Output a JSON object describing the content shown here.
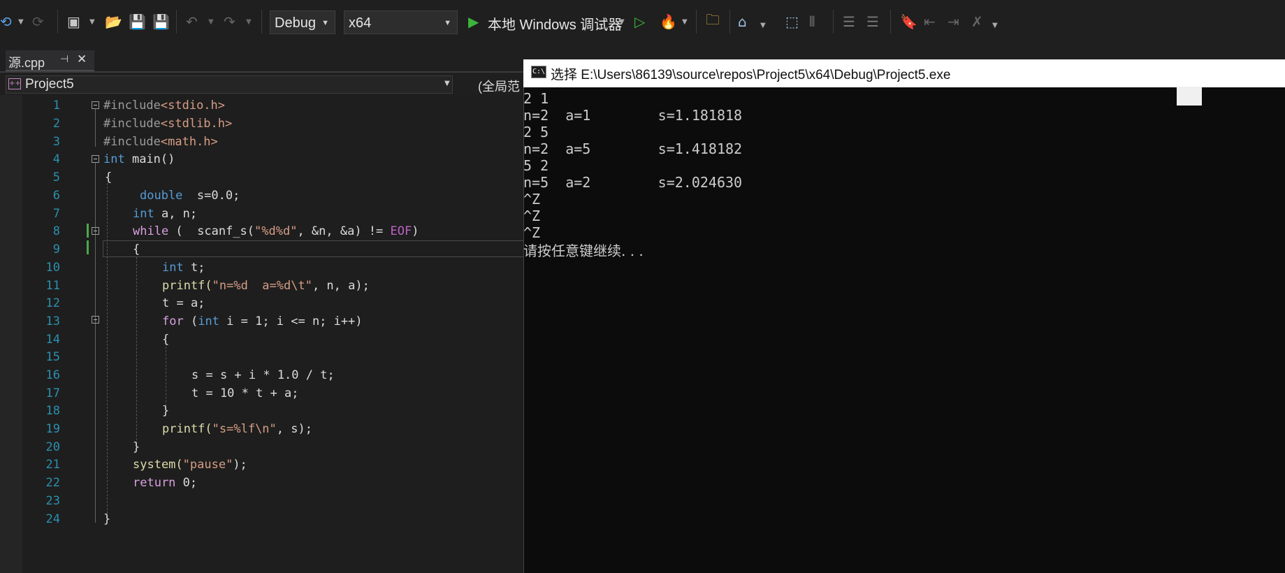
{
  "toolbar": {
    "config": "Debug",
    "platform": "x64",
    "run_label": "本地 Windows 调试器"
  },
  "tab": {
    "name": "源.cpp",
    "pin": "⊣",
    "close": "✕"
  },
  "nav": {
    "project": "Project5",
    "scope": "(全局范"
  },
  "code_lines": [
    {
      "n": "1"
    },
    {
      "n": "2"
    },
    {
      "n": "3"
    },
    {
      "n": "4"
    },
    {
      "n": "5"
    },
    {
      "n": "6"
    },
    {
      "n": "7"
    },
    {
      "n": "8"
    },
    {
      "n": "9"
    },
    {
      "n": "10"
    },
    {
      "n": "11"
    },
    {
      "n": "12"
    },
    {
      "n": "13"
    },
    {
      "n": "14"
    },
    {
      "n": "15"
    },
    {
      "n": "16"
    },
    {
      "n": "17"
    },
    {
      "n": "18"
    },
    {
      "n": "19"
    },
    {
      "n": "20"
    },
    {
      "n": "21"
    },
    {
      "n": "22"
    },
    {
      "n": "23"
    },
    {
      "n": "24"
    }
  ],
  "code": {
    "l1a": "#include",
    "l1b": "<stdio.h>",
    "l2a": "#include",
    "l2b": "<stdlib.h>",
    "l3a": "#include",
    "l3b": "<math.h>",
    "l4a": "int",
    "l4b": " main()",
    "l5": "{",
    "l6a": "double",
    "l6b": "  s=0.0;",
    "l7a": "int",
    "l7b": " a, n;",
    "l8a": "while",
    "l8b": " (  scanf_s(",
    "l8c": "\"%d%d\"",
    "l8d": ", &n, &a) != ",
    "l8e": "EOF",
    "l8f": ")",
    "l9": "{",
    "l10a": "int",
    "l10b": " t;",
    "l11a": "printf(",
    "l11b": "\"n=%d  a=%d\\t\"",
    "l11c": ", n, a);",
    "l12": "t = a;",
    "l13a": "for",
    "l13b": " (",
    "l13c": "int",
    "l13d": " i = 1; i <= n; i++)",
    "l14": "{",
    "l16": "s = s + i * 1.0 / t;",
    "l17": "t = 10 * t + a;",
    "l18": "}",
    "l19a": "printf(",
    "l19b": "\"s=%lf\\n\"",
    "l19c": ", s);",
    "l20": "}",
    "l21a": "system(",
    "l21b": "\"pause\"",
    "l21c": ");",
    "l22a": "return",
    "l22b": " 0;",
    "l24": "}"
  },
  "console": {
    "title": "选择 E:\\Users\\86139\\source\\repos\\Project5\\x64\\Debug\\Project5.exe",
    "icon_text": "C:\\",
    "lines": [
      "2 1",
      "n=2  a=1        s=1.181818",
      "2 5",
      "n=2  a=5        s=1.418182",
      "5 2",
      "n=5  a=2        s=2.024630",
      "^Z",
      "^Z",
      "^Z"
    ],
    "pause": "请按任意键继续. . ."
  }
}
